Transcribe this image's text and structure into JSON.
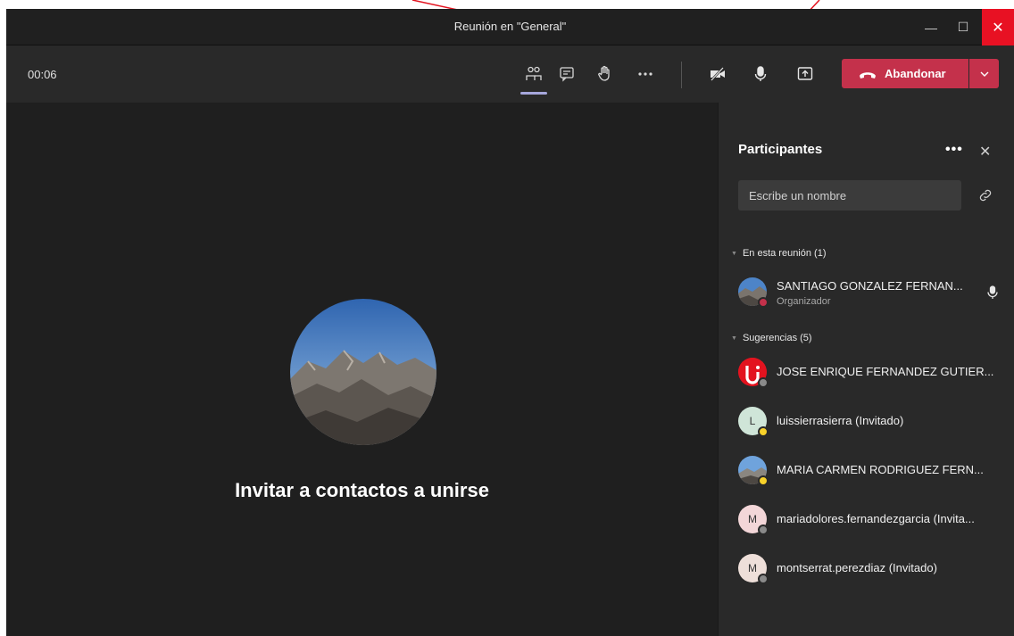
{
  "window": {
    "title": "Reunión en \"General\""
  },
  "toolbar": {
    "timer": "00:06",
    "leave_label": "Abandonar"
  },
  "stage": {
    "invite_text": "Invitar a contactos a unirse"
  },
  "panel": {
    "title": "Participantes",
    "more": "•••",
    "close": "✕",
    "search_placeholder": "Escribe un nombre",
    "in_meeting_header": "En esta reunión (1)",
    "suggestions_header": "Sugerencias (5)",
    "organizer": {
      "name": "SANTIAGO GONZALEZ FERNAN...",
      "role": "Organizador"
    },
    "suggestions": [
      {
        "name": "JOSE ENRIQUE FERNANDEZ GUTIER...",
        "initial": ""
      },
      {
        "name": "luissierrasierra (Invitado)",
        "initial": "L"
      },
      {
        "name": "MARIA CARMEN RODRIGUEZ FERN...",
        "initial": ""
      },
      {
        "name": "mariadolores.fernandezgarcia (Invita...",
        "initial": "M"
      },
      {
        "name": "montserrat.perezdiaz (Invitado)",
        "initial": "M"
      }
    ]
  },
  "colors": {
    "leave": "#c4314b",
    "close": "#e81123",
    "annotation_arrow": "#e3131f",
    "active_tab": "#a6a7dc"
  }
}
